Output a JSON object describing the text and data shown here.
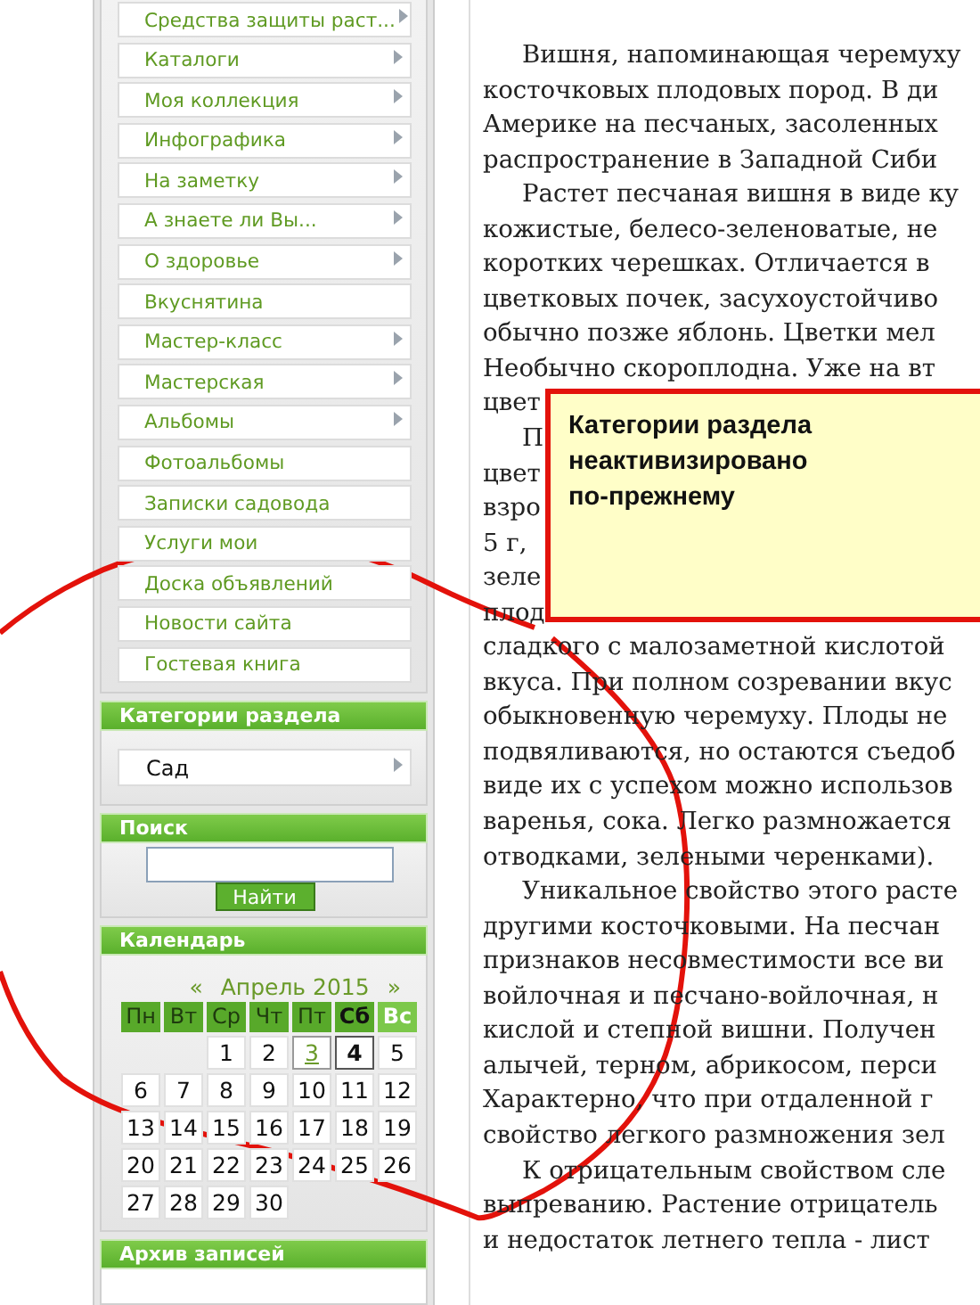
{
  "menu": [
    {
      "label": "Средства защиты раст...",
      "submenu": true
    },
    {
      "label": "Каталоги",
      "submenu": true
    },
    {
      "label": "Моя коллекция",
      "submenu": true
    },
    {
      "label": "Инфографика",
      "submenu": true
    },
    {
      "label": "На заметку",
      "submenu": true
    },
    {
      "label": "А знаете ли Вы...",
      "submenu": true
    },
    {
      "label": "О здоровье",
      "submenu": true
    },
    {
      "label": "Вкуснятина",
      "submenu": false
    },
    {
      "label": "Мастер-класс",
      "submenu": true
    },
    {
      "label": "Мастерская",
      "submenu": true
    },
    {
      "label": "Альбомы",
      "submenu": true
    },
    {
      "label": "Фотоальбомы",
      "submenu": false
    },
    {
      "label": "Записки садовода",
      "submenu": false
    },
    {
      "label": "Услуги мои",
      "submenu": false
    },
    {
      "label": "Доска объявлений",
      "submenu": false
    },
    {
      "label": "Новости сайта",
      "submenu": false
    },
    {
      "label": "Гостевая книга",
      "submenu": false
    }
  ],
  "categories": {
    "title": "Категории раздела",
    "items": [
      {
        "label": "Сад",
        "submenu": true
      }
    ]
  },
  "search": {
    "title": "Поиск",
    "button": "Найти"
  },
  "calendar": {
    "title": "Календарь",
    "prev": "«",
    "month": "Апрель 2015",
    "next": "»",
    "weekdays": [
      {
        "label": "Пн",
        "kind": "weekday"
      },
      {
        "label": "Вт",
        "kind": "weekday"
      },
      {
        "label": "Ср",
        "kind": "weekday"
      },
      {
        "label": "Чт",
        "kind": "weekday"
      },
      {
        "label": "Пт",
        "kind": "weekday"
      },
      {
        "label": "Сб",
        "kind": "saturday"
      },
      {
        "label": "Вс",
        "kind": "sunday"
      }
    ],
    "weeks": [
      [
        {
          "kind": "blank"
        },
        {
          "kind": "blank"
        },
        {
          "day": "1",
          "kind": "plain"
        },
        {
          "day": "2",
          "kind": "plain"
        },
        {
          "day": "3",
          "kind": "link"
        },
        {
          "day": "4",
          "kind": "today"
        },
        {
          "day": "5",
          "kind": "plain"
        }
      ],
      [
        {
          "day": "6",
          "kind": "plain"
        },
        {
          "day": "7",
          "kind": "plain"
        },
        {
          "day": "8",
          "kind": "plain"
        },
        {
          "day": "9",
          "kind": "plain"
        },
        {
          "day": "10",
          "kind": "plain"
        },
        {
          "day": "11",
          "kind": "plain"
        },
        {
          "day": "12",
          "kind": "plain"
        }
      ],
      [
        {
          "day": "13",
          "kind": "plain"
        },
        {
          "day": "14",
          "kind": "plain"
        },
        {
          "day": "15",
          "kind": "plain"
        },
        {
          "day": "16",
          "kind": "plain"
        },
        {
          "day": "17",
          "kind": "plain"
        },
        {
          "day": "18",
          "kind": "plain"
        },
        {
          "day": "19",
          "kind": "plain"
        }
      ],
      [
        {
          "day": "20",
          "kind": "plain"
        },
        {
          "day": "21",
          "kind": "plain"
        },
        {
          "day": "22",
          "kind": "plain"
        },
        {
          "day": "23",
          "kind": "plain"
        },
        {
          "day": "24",
          "kind": "plain"
        },
        {
          "day": "25",
          "kind": "plain"
        },
        {
          "day": "26",
          "kind": "plain"
        }
      ],
      [
        {
          "day": "27",
          "kind": "plain"
        },
        {
          "day": "28",
          "kind": "plain"
        },
        {
          "day": "29",
          "kind": "plain"
        },
        {
          "day": "30",
          "kind": "plain"
        }
      ]
    ]
  },
  "archive": {
    "title": "Архив записей"
  },
  "article": {
    "lines": [
      {
        "text": "Вишня, напоминающая черемуху",
        "indent": true
      },
      {
        "text": "косточковых плодовых пород. В ди",
        "indent": false
      },
      {
        "text": "Америке на песчаных, засоленных",
        "indent": false
      },
      {
        "text": "распространение в Западной Сиби",
        "indent": false
      },
      {
        "text": "Растет песчаная вишня в виде ку",
        "indent": true
      },
      {
        "text": "кожистые, белесо-зеленоватые, не",
        "indent": false
      },
      {
        "text": "коротких черешках. Отличается в",
        "indent": false
      },
      {
        "text": "цветковых почек, засухоустойчиво",
        "indent": false
      },
      {
        "text": "обычно позже яблонь. Цветки мел",
        "indent": false
      },
      {
        "text": "Необычно скороплодна. Уже на вт",
        "indent": false
      },
      {
        "text": "цвет",
        "indent": false
      },
      {
        "text": "П",
        "indent": true
      },
      {
        "text": "цвет",
        "indent": false
      },
      {
        "text": "взро",
        "indent": false
      },
      {
        "text": "5 г,",
        "indent": false
      },
      {
        "text": "зеле",
        "indent": false
      },
      {
        "text": "плод",
        "indent": false
      },
      {
        "text": "сладкого с малозаметной кислотой",
        "indent": false
      },
      {
        "text": "вкуса. При полном созревании вкус",
        "indent": false
      },
      {
        "text": "обыкновенную черемуху. Плоды не",
        "indent": false
      },
      {
        "text": "подвяливаются, но остаются съедоб",
        "indent": false
      },
      {
        "text": "виде их с успехом можно использов",
        "indent": false
      },
      {
        "text": "варенья, сока. Легко размножается",
        "indent": false
      },
      {
        "text": "отводками, зелеными черенками).",
        "indent": false
      },
      {
        "text": "Уникальное свойство этого расте",
        "indent": true
      },
      {
        "text": "другими косточковыми. На песчан",
        "indent": false
      },
      {
        "text": "признаков несовместимости все ви",
        "indent": false
      },
      {
        "text": "войлочная и песчано-войлочная, н",
        "indent": false
      },
      {
        "text": "кислой и степной вишни. Получен",
        "indent": false
      },
      {
        "text": "алычей, терном, абрикосом, перси",
        "indent": false
      },
      {
        "text": "Характерно, что при отдаленной г",
        "indent": false
      },
      {
        "text": "свойство легкого размножения зел",
        "indent": false
      },
      {
        "text": "К отрицательным свойством сле",
        "indent": true
      },
      {
        "text": "выпреванию. Растение отрицатель",
        "indent": false
      },
      {
        "text": "и недостаток летнего тепла - лист",
        "indent": false
      }
    ]
  },
  "note": {
    "lines": [
      "Категории раздела",
      "неактивизировано",
      "по-прежнему"
    ]
  }
}
